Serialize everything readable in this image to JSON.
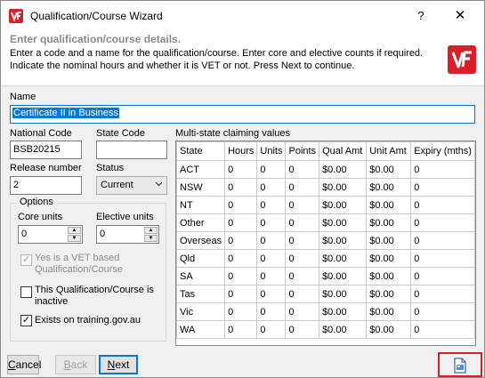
{
  "window": {
    "title": "Qualification/Course Wizard",
    "help_glyph": "?",
    "close_glyph": "✕",
    "brand_color": "#d8202a",
    "accent_color": "#0078d7"
  },
  "header": {
    "title": "Enter qualification/course details.",
    "description": "Enter a code and a name for the qualification/course.  Enter core and elective counts if required.  Indicate the nominal hours and whether it is VET or not.  Press Next to continue."
  },
  "form": {
    "name_label": "Name",
    "name_value": "Certificate II in Business",
    "national_code_label": "National Code",
    "national_code_value": "BSB20215",
    "state_code_label": "State Code",
    "state_code_value": "",
    "release_number_label": "Release number",
    "release_number_value": "2",
    "status_label": "Status",
    "status_value": "Current",
    "options": {
      "legend": "Options",
      "core_units_label": "Core units",
      "core_units_value": "0",
      "elective_units_label": "Elective units",
      "elective_units_value": "0",
      "vet_based_label": "Yes is a VET based Qualification/Course",
      "vet_based_checked": true,
      "vet_based_enabled": false,
      "inactive_label": "This Qualification/Course is inactive",
      "inactive_checked": false,
      "exists_label": "Exists on training.gov.au",
      "exists_checked": true
    }
  },
  "multistate": {
    "label": "Multi-state claiming values",
    "columns": [
      "State",
      "Hours",
      "Units",
      "Points",
      "Qual Amt",
      "Unit Amt",
      "Expiry (mths)"
    ],
    "rows": [
      [
        "ACT",
        "0",
        "0",
        "0",
        "$0.00",
        "$0.00",
        "0"
      ],
      [
        "NSW",
        "0",
        "0",
        "0",
        "$0.00",
        "$0.00",
        "0"
      ],
      [
        "NT",
        "0",
        "0",
        "0",
        "$0.00",
        "$0.00",
        "0"
      ],
      [
        "Other",
        "0",
        "0",
        "0",
        "$0.00",
        "$0.00",
        "0"
      ],
      [
        "Overseas",
        "0",
        "0",
        "0",
        "$0.00",
        "$0.00",
        "0"
      ],
      [
        "Qld",
        "0",
        "0",
        "0",
        "$0.00",
        "$0.00",
        "0"
      ],
      [
        "SA",
        "0",
        "0",
        "0",
        "$0.00",
        "$0.00",
        "0"
      ],
      [
        "Tas",
        "0",
        "0",
        "0",
        "$0.00",
        "$0.00",
        "0"
      ],
      [
        "Vic",
        "0",
        "0",
        "0",
        "$0.00",
        "$0.00",
        "0"
      ],
      [
        "WA",
        "0",
        "0",
        "0",
        "$0.00",
        "$0.00",
        "0"
      ]
    ]
  },
  "footer": {
    "cancel_label": "Cancel",
    "cancel_access_key": "C",
    "back_label": "Back",
    "back_access_key": "B",
    "next_label": "Next",
    "next_access_key": "N",
    "corner_icon": "document-icon"
  }
}
